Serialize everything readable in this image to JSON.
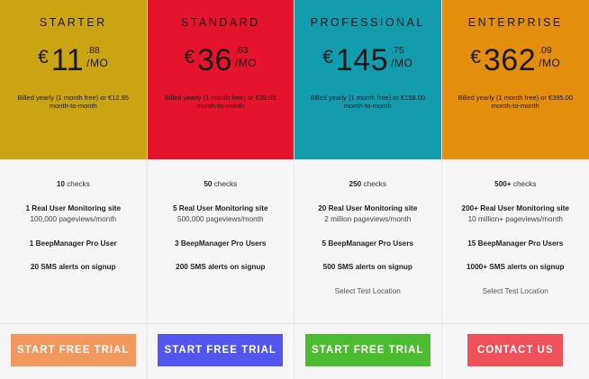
{
  "plans": [
    {
      "name": "STARTER",
      "currency": "€",
      "price_whole": "11",
      "price_cents": ".88",
      "per": "/MO",
      "billing": "Billed yearly (1 month free) or €12.95 month-to-month",
      "header_color": "#cba413",
      "features": [
        {
          "bold": "10",
          "text": " checks"
        },
        {
          "bold": "1 Real User Monitoring site",
          "sub": "100,000 pageviews/month"
        },
        {
          "bold": "1 BeepManager Pro User"
        },
        {
          "bold": "20 SMS alerts on signup"
        }
      ],
      "button_label": "START FREE TRIAL",
      "button_color": "#f0985e"
    },
    {
      "name": "STANDARD",
      "currency": "€",
      "price_whole": "36",
      "price_cents": ".63",
      "per": "/MO",
      "billing": "Billed yearly (1 month free) or €39.95 month-to-month",
      "header_color": "#e5132b",
      "features": [
        {
          "bold": "50",
          "text": " checks"
        },
        {
          "bold": "5 Real User Monitoring site",
          "sub": "500,000 pageviews/month"
        },
        {
          "bold": "3 BeepManager Pro Users"
        },
        {
          "bold": "200 SMS alerts on signup"
        }
      ],
      "button_label": "START FREE TRIAL",
      "button_color": "#5356ee"
    },
    {
      "name": "PROFESSIONAL",
      "currency": "€",
      "price_whole": "145",
      "price_cents": ".75",
      "per": "/MO",
      "billing": "Billed yearly (1 month free) or €159.00 month-to-month",
      "header_color": "#139bae",
      "features": [
        {
          "bold": "250",
          "text": " checks"
        },
        {
          "bold": "20 Real User Monitoring site",
          "sub": "2 million pageviews/month"
        },
        {
          "bold": "5 BeepManager Pro Users"
        },
        {
          "bold": "500 SMS alerts on signup"
        },
        {
          "plain": "Select Test Location"
        }
      ],
      "button_label": "START FREE TRIAL",
      "button_color": "#4bbc2f"
    },
    {
      "name": "ENTERPRISE",
      "currency": "€",
      "price_whole": "362",
      "price_cents": ".09",
      "per": "/MO",
      "billing": "Billed yearly (1 month free) or €395.00 month-to-month",
      "header_color": "#e38e0c",
      "features": [
        {
          "bold": "500+",
          "text": " checks"
        },
        {
          "bold": "200+ Real User Monitoring site",
          "sub": "10 million+ pageviews/month"
        },
        {
          "bold": "15 BeepManager Pro Users"
        },
        {
          "bold": "1000+ SMS alerts on signup"
        },
        {
          "plain": "Select Test Location"
        }
      ],
      "button_label": "CONTACT US",
      "button_color": "#ee5159"
    }
  ]
}
